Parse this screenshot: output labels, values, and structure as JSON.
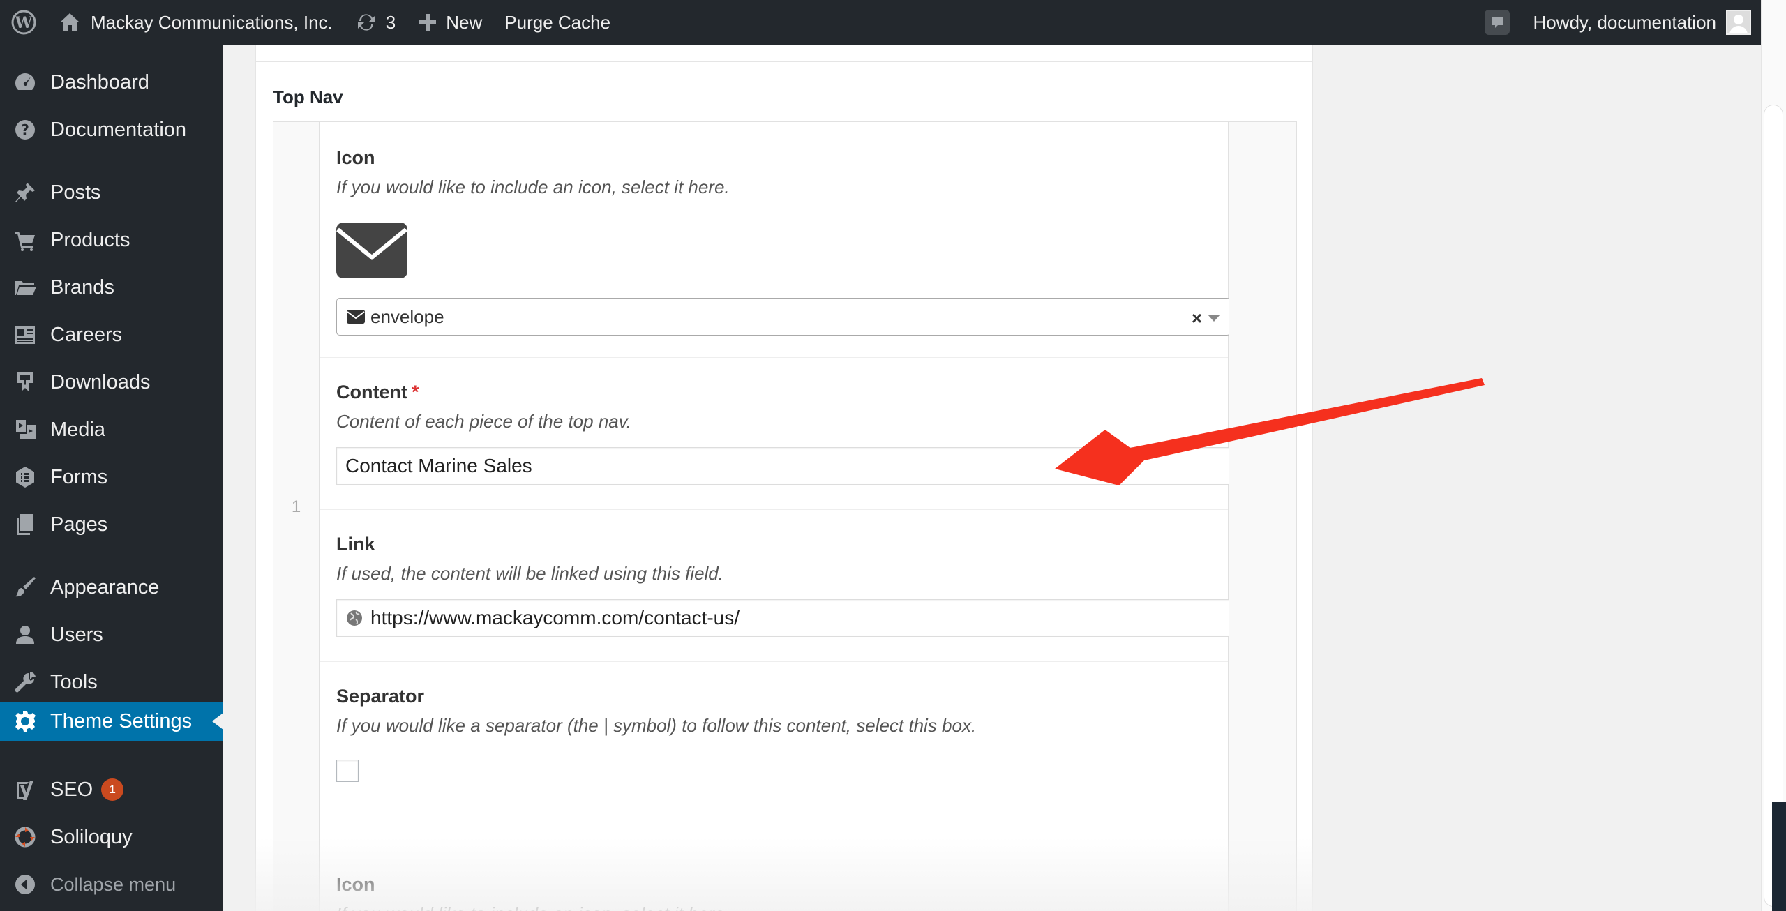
{
  "adminbar": {
    "site_name": "Mackay Communications, Inc.",
    "updates_count": "3",
    "new_label": "New",
    "purge_label": "Purge Cache",
    "howdy": "Howdy, documentation"
  },
  "sidebar": {
    "items": [
      {
        "label": "Dashboard",
        "icon": "dashboard-icon"
      },
      {
        "label": "Documentation",
        "icon": "help-icon"
      },
      {
        "label": "Posts",
        "icon": "pin-icon"
      },
      {
        "label": "Products",
        "icon": "cart-icon"
      },
      {
        "label": "Brands",
        "icon": "folder-icon"
      },
      {
        "label": "Careers",
        "icon": "id-card-icon"
      },
      {
        "label": "Downloads",
        "icon": "download-icon"
      },
      {
        "label": "Media",
        "icon": "media-icon"
      },
      {
        "label": "Forms",
        "icon": "forms-icon"
      },
      {
        "label": "Pages",
        "icon": "pages-icon"
      },
      {
        "label": "Appearance",
        "icon": "brush-icon"
      },
      {
        "label": "Users",
        "icon": "users-icon"
      },
      {
        "label": "Tools",
        "icon": "wrench-icon"
      },
      {
        "label": "Theme Settings",
        "icon": "gear-icon",
        "active": true
      },
      {
        "label": "SEO",
        "icon": "yoast-icon",
        "badge": "1"
      },
      {
        "label": "Soliloquy",
        "icon": "soliloquy-icon"
      },
      {
        "label": "Collapse menu",
        "icon": "collapse-icon"
      }
    ]
  },
  "main": {
    "section_title": "Top Nav",
    "row1": {
      "number": "1",
      "icon_field": {
        "label": "Icon",
        "description": "If you would like to include an icon, select it here.",
        "selected_value": "envelope"
      },
      "content_field": {
        "label": "Content",
        "required_mark": "*",
        "description": "Content of each piece of the top nav.",
        "value": "Contact Marine Sales"
      },
      "link_field": {
        "label": "Link",
        "description": "If used, the content will be linked using this field.",
        "value": "https://www.mackaycomm.com/contact-us/"
      },
      "separator_field": {
        "label": "Separator",
        "description": "If you would like a separator (the | symbol) to follow this content, select this box.",
        "checked": false
      }
    },
    "row2": {
      "icon_field": {
        "label": "Icon",
        "description": "If you would like to include an icon, select it here."
      }
    }
  },
  "colors": {
    "adminbar_bg": "#23282d",
    "active_menu": "#0073aa",
    "annotation_arrow": "#f5301e",
    "badge": "#ca4a1f"
  }
}
